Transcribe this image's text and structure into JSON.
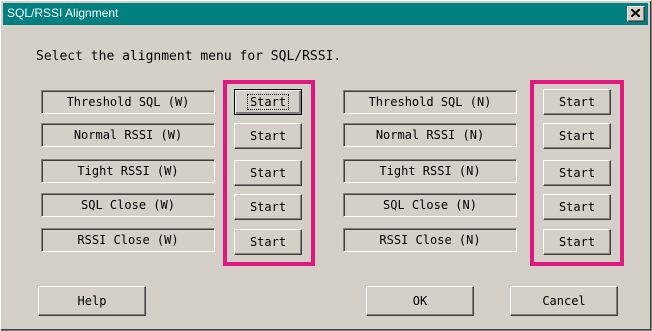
{
  "window": {
    "title": "SQL/RSSI Alignment",
    "close_icon": "close-x-icon"
  },
  "prompt": "Select the alignment menu for SQL/RSSI.",
  "left_group": {
    "items": [
      {
        "label": "Threshold SQL (W)",
        "button": "Start"
      },
      {
        "label": "Normal RSSI (W)",
        "button": "Start"
      },
      {
        "label": "Tight RSSI (W)",
        "button": "Start"
      },
      {
        "label": "SQL Close (W)",
        "button": "Start"
      },
      {
        "label": "RSSI Close (W)",
        "button": "Start"
      }
    ]
  },
  "right_group": {
    "items": [
      {
        "label": "Threshold SQL (N)",
        "button": "Start"
      },
      {
        "label": "Normal RSSI (N)",
        "button": "Start"
      },
      {
        "label": "Tight RSSI (N)",
        "button": "Start"
      },
      {
        "label": "SQL Close (N)",
        "button": "Start"
      },
      {
        "label": "RSSI Close (N)",
        "button": "Start"
      }
    ]
  },
  "footer": {
    "help": "Help",
    "ok": "OK",
    "cancel": "Cancel"
  },
  "colors": {
    "titlebar": "#008080",
    "highlight": "#e0187f",
    "face": "#d4d0c8"
  }
}
